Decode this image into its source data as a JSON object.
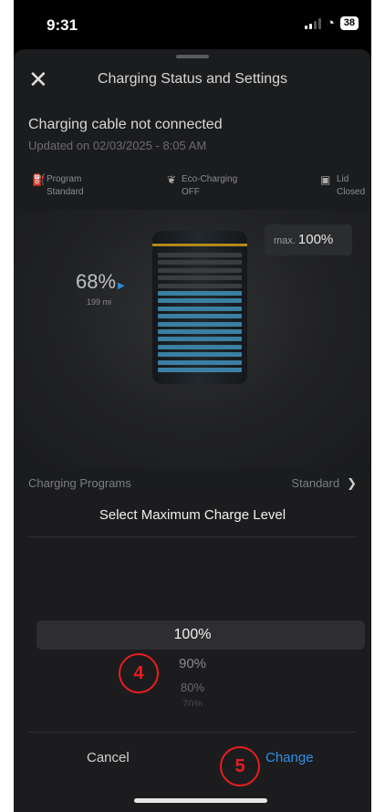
{
  "status_bar": {
    "time": "9:31",
    "battery": "38"
  },
  "sheet": {
    "title": "Charging Status and Settings",
    "cable_status": "Charging cable not connected",
    "updated": "Updated on 02/03/2025 - 8:05 AM",
    "info": [
      {
        "label": "Program",
        "value": "Standard",
        "icon": "charger-icon"
      },
      {
        "label": "Eco-Charging",
        "value": "OFF",
        "icon": "leaf-icon"
      },
      {
        "label": "Lid",
        "value": "Closed",
        "icon": "lid-icon"
      }
    ],
    "state_of_charge": "68%",
    "range": "199 mi",
    "max_prefix": "max.",
    "max_value": "100%",
    "programs_label": "Charging Programs",
    "programs_value": "Standard",
    "charge_fraction": 0.68
  },
  "picker": {
    "title": "Select Maximum Charge Level",
    "selected": "100%",
    "options": [
      "90%",
      "80%",
      "70%"
    ],
    "cancel_label": "Cancel",
    "change_label": "Change"
  },
  "annotations": [
    "4",
    "5"
  ],
  "colors": {
    "accent": "#2f8fe8",
    "annotation": "#e81e1e",
    "battery_bar": "#3b7fa3",
    "limit_line": "#b18a1a"
  }
}
